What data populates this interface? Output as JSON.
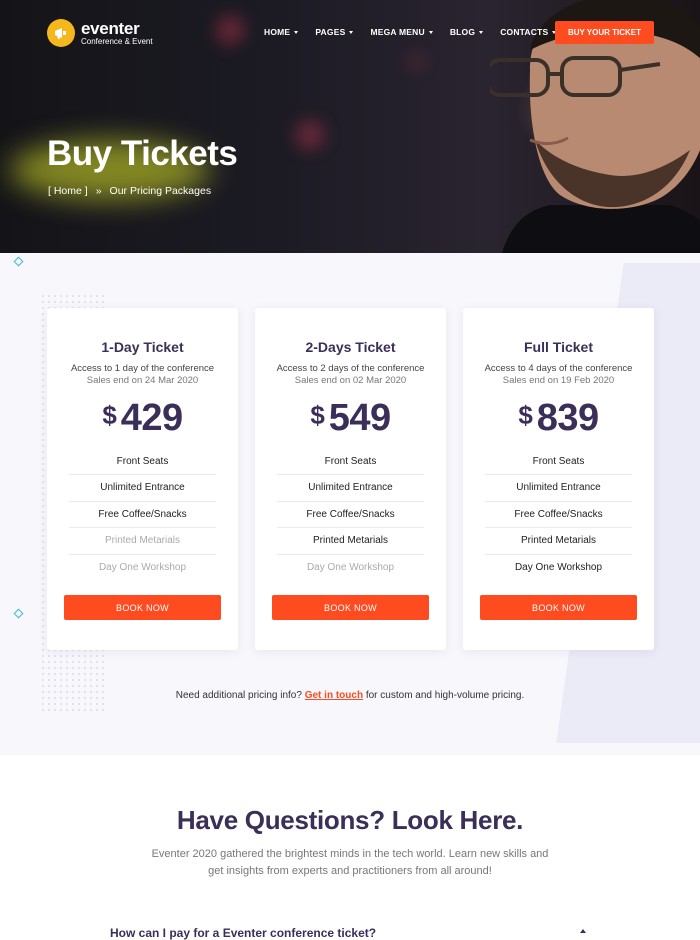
{
  "brand": {
    "name": "eventer",
    "tagline": "Conference & Event"
  },
  "nav": {
    "items": [
      {
        "label": "HOME"
      },
      {
        "label": "PAGES"
      },
      {
        "label": "MEGA MENU"
      },
      {
        "label": "BLOG"
      },
      {
        "label": "CONTACTS"
      }
    ],
    "cta": "BUY YOUR TICKET"
  },
  "hero": {
    "title": "Buy Tickets",
    "breadcrumb": {
      "home": "[ Home ]",
      "separator": "»",
      "current": "Our Pricing Packages"
    }
  },
  "pricing": {
    "cards": [
      {
        "title": "1-Day Ticket",
        "desc": "Access to 1 day of the conference",
        "sales": "Sales end on 24 Mar 2020",
        "currency": "$",
        "amount": "429",
        "features": [
          {
            "label": "Front Seats",
            "included": true
          },
          {
            "label": "Unlimited Entrance",
            "included": true
          },
          {
            "label": "Free Coffee/Snacks",
            "included": true
          },
          {
            "label": "Printed Metarials",
            "included": false
          },
          {
            "label": "Day One Workshop",
            "included": false
          }
        ],
        "button": "BOOK NOW"
      },
      {
        "title": "2-Days Ticket",
        "desc": "Access to 2 days of the conference",
        "sales": "Sales end on 02 Mar 2020",
        "currency": "$",
        "amount": "549",
        "features": [
          {
            "label": "Front Seats",
            "included": true
          },
          {
            "label": "Unlimited Entrance",
            "included": true
          },
          {
            "label": "Free Coffee/Snacks",
            "included": true
          },
          {
            "label": "Printed Metarials",
            "included": true
          },
          {
            "label": "Day One Workshop",
            "included": false
          }
        ],
        "button": "BOOK NOW"
      },
      {
        "title": "Full Ticket",
        "desc": "Access to 4 days of the conference",
        "sales": "Sales end on 19 Feb 2020",
        "currency": "$",
        "amount": "839",
        "features": [
          {
            "label": "Front Seats",
            "included": true
          },
          {
            "label": "Unlimited Entrance",
            "included": true
          },
          {
            "label": "Free Coffee/Snacks",
            "included": true
          },
          {
            "label": "Printed Metarials",
            "included": true
          },
          {
            "label": "Day One Workshop",
            "included": true
          }
        ],
        "button": "BOOK NOW"
      }
    ],
    "note": {
      "before": "Need additional pricing info?",
      "link": "Get in touch",
      "after": "for custom and high-volume pricing."
    }
  },
  "faq": {
    "title": "Have Questions? Look Here.",
    "subtitle": "Eventer 2020 gathered the brightest minds in the tech world. Learn new skills and get insights from experts and practitioners from all around!",
    "first_question": "How can I pay for a Eventer conference ticket?"
  },
  "colors": {
    "accent": "#fe4b1f",
    "heading": "#3b2e58",
    "logo": "#f4b81c",
    "decor": "#3bb7d6"
  }
}
